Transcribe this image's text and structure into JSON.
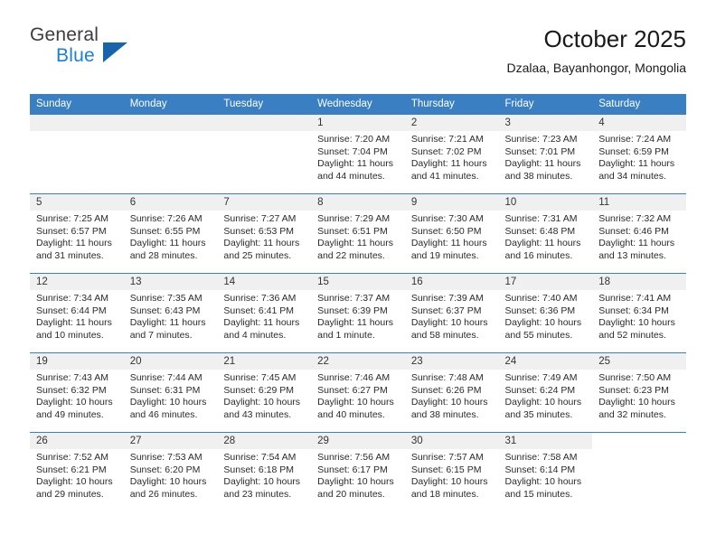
{
  "brand": {
    "name_top": "General",
    "name_bottom": "Blue",
    "accent_color": "#1b7fd4",
    "triangle_color": "#1664ab",
    "logo_icon": "general-blue-logo"
  },
  "header": {
    "title": "October 2025",
    "subtitle": "Dzalaa, Bayanhongor, Mongolia"
  },
  "calendar": {
    "header_background": "#3a7fc1",
    "header_text_color": "#ffffff",
    "date_band_background": "#f0f0f0",
    "weekday_headers": [
      "Sunday",
      "Monday",
      "Tuesday",
      "Wednesday",
      "Thursday",
      "Friday",
      "Saturday"
    ],
    "weeks": [
      [
        {
          "day": "",
          "blank": true,
          "lines": []
        },
        {
          "day": "",
          "blank": true,
          "lines": []
        },
        {
          "day": "",
          "blank": true,
          "lines": []
        },
        {
          "day": "1",
          "lines": [
            "Sunrise: 7:20 AM",
            "Sunset: 7:04 PM",
            "Daylight: 11 hours",
            "and 44 minutes."
          ]
        },
        {
          "day": "2",
          "lines": [
            "Sunrise: 7:21 AM",
            "Sunset: 7:02 PM",
            "Daylight: 11 hours",
            "and 41 minutes."
          ]
        },
        {
          "day": "3",
          "lines": [
            "Sunrise: 7:23 AM",
            "Sunset: 7:01 PM",
            "Daylight: 11 hours",
            "and 38 minutes."
          ]
        },
        {
          "day": "4",
          "lines": [
            "Sunrise: 7:24 AM",
            "Sunset: 6:59 PM",
            "Daylight: 11 hours",
            "and 34 minutes."
          ]
        }
      ],
      [
        {
          "day": "5",
          "lines": [
            "Sunrise: 7:25 AM",
            "Sunset: 6:57 PM",
            "Daylight: 11 hours",
            "and 31 minutes."
          ]
        },
        {
          "day": "6",
          "lines": [
            "Sunrise: 7:26 AM",
            "Sunset: 6:55 PM",
            "Daylight: 11 hours",
            "and 28 minutes."
          ]
        },
        {
          "day": "7",
          "lines": [
            "Sunrise: 7:27 AM",
            "Sunset: 6:53 PM",
            "Daylight: 11 hours",
            "and 25 minutes."
          ]
        },
        {
          "day": "8",
          "lines": [
            "Sunrise: 7:29 AM",
            "Sunset: 6:51 PM",
            "Daylight: 11 hours",
            "and 22 minutes."
          ]
        },
        {
          "day": "9",
          "lines": [
            "Sunrise: 7:30 AM",
            "Sunset: 6:50 PM",
            "Daylight: 11 hours",
            "and 19 minutes."
          ]
        },
        {
          "day": "10",
          "lines": [
            "Sunrise: 7:31 AM",
            "Sunset: 6:48 PM",
            "Daylight: 11 hours",
            "and 16 minutes."
          ]
        },
        {
          "day": "11",
          "lines": [
            "Sunrise: 7:32 AM",
            "Sunset: 6:46 PM",
            "Daylight: 11 hours",
            "and 13 minutes."
          ]
        }
      ],
      [
        {
          "day": "12",
          "lines": [
            "Sunrise: 7:34 AM",
            "Sunset: 6:44 PM",
            "Daylight: 11 hours",
            "and 10 minutes."
          ]
        },
        {
          "day": "13",
          "lines": [
            "Sunrise: 7:35 AM",
            "Sunset: 6:43 PM",
            "Daylight: 11 hours",
            "and 7 minutes."
          ]
        },
        {
          "day": "14",
          "lines": [
            "Sunrise: 7:36 AM",
            "Sunset: 6:41 PM",
            "Daylight: 11 hours",
            "and 4 minutes."
          ]
        },
        {
          "day": "15",
          "lines": [
            "Sunrise: 7:37 AM",
            "Sunset: 6:39 PM",
            "Daylight: 11 hours",
            "and 1 minute."
          ]
        },
        {
          "day": "16",
          "lines": [
            "Sunrise: 7:39 AM",
            "Sunset: 6:37 PM",
            "Daylight: 10 hours",
            "and 58 minutes."
          ]
        },
        {
          "day": "17",
          "lines": [
            "Sunrise: 7:40 AM",
            "Sunset: 6:36 PM",
            "Daylight: 10 hours",
            "and 55 minutes."
          ]
        },
        {
          "day": "18",
          "lines": [
            "Sunrise: 7:41 AM",
            "Sunset: 6:34 PM",
            "Daylight: 10 hours",
            "and 52 minutes."
          ]
        }
      ],
      [
        {
          "day": "19",
          "lines": [
            "Sunrise: 7:43 AM",
            "Sunset: 6:32 PM",
            "Daylight: 10 hours",
            "and 49 minutes."
          ]
        },
        {
          "day": "20",
          "lines": [
            "Sunrise: 7:44 AM",
            "Sunset: 6:31 PM",
            "Daylight: 10 hours",
            "and 46 minutes."
          ]
        },
        {
          "day": "21",
          "lines": [
            "Sunrise: 7:45 AM",
            "Sunset: 6:29 PM",
            "Daylight: 10 hours",
            "and 43 minutes."
          ]
        },
        {
          "day": "22",
          "lines": [
            "Sunrise: 7:46 AM",
            "Sunset: 6:27 PM",
            "Daylight: 10 hours",
            "and 40 minutes."
          ]
        },
        {
          "day": "23",
          "lines": [
            "Sunrise: 7:48 AM",
            "Sunset: 6:26 PM",
            "Daylight: 10 hours",
            "and 38 minutes."
          ]
        },
        {
          "day": "24",
          "lines": [
            "Sunrise: 7:49 AM",
            "Sunset: 6:24 PM",
            "Daylight: 10 hours",
            "and 35 minutes."
          ]
        },
        {
          "day": "25",
          "lines": [
            "Sunrise: 7:50 AM",
            "Sunset: 6:23 PM",
            "Daylight: 10 hours",
            "and 32 minutes."
          ]
        }
      ],
      [
        {
          "day": "26",
          "lines": [
            "Sunrise: 7:52 AM",
            "Sunset: 6:21 PM",
            "Daylight: 10 hours",
            "and 29 minutes."
          ]
        },
        {
          "day": "27",
          "lines": [
            "Sunrise: 7:53 AM",
            "Sunset: 6:20 PM",
            "Daylight: 10 hours",
            "and 26 minutes."
          ]
        },
        {
          "day": "28",
          "lines": [
            "Sunrise: 7:54 AM",
            "Sunset: 6:18 PM",
            "Daylight: 10 hours",
            "and 23 minutes."
          ]
        },
        {
          "day": "29",
          "lines": [
            "Sunrise: 7:56 AM",
            "Sunset: 6:17 PM",
            "Daylight: 10 hours",
            "and 20 minutes."
          ]
        },
        {
          "day": "30",
          "lines": [
            "Sunrise: 7:57 AM",
            "Sunset: 6:15 PM",
            "Daylight: 10 hours",
            "and 18 minutes."
          ]
        },
        {
          "day": "31",
          "lines": [
            "Sunrise: 7:58 AM",
            "Sunset: 6:14 PM",
            "Daylight: 10 hours",
            "and 15 minutes."
          ]
        },
        {
          "day": "",
          "blank": true,
          "empty_band": true,
          "lines": []
        }
      ]
    ]
  }
}
